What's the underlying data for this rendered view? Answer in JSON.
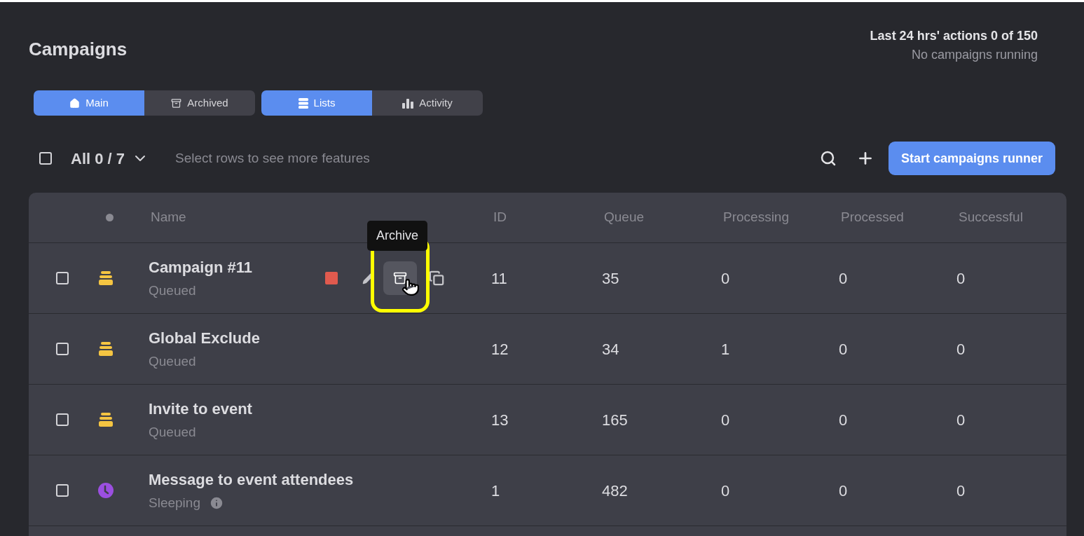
{
  "title": "Campaigns",
  "usage": {
    "actions": "Last 24 hrs' actions 0 of 150",
    "running": "No campaigns running"
  },
  "tab_groups": [
    [
      {
        "label": "Main",
        "selected": true
      },
      {
        "label": "Archived",
        "selected": false
      }
    ],
    [
      {
        "label": "Lists",
        "selected": true
      },
      {
        "label": "Activity",
        "selected": false
      }
    ]
  ],
  "selection": {
    "checked": false,
    "label": "All 0 / 7",
    "hint": "Select rows to see more features"
  },
  "start_button": "Start campaigns runner",
  "table": {
    "columns": [
      "Name",
      "ID",
      "Queue",
      "Processing",
      "Processed",
      "Successful"
    ],
    "rows": [
      {
        "name": "Campaign #11",
        "status": "Queued",
        "kind": "queued",
        "checked": false,
        "hovered": true,
        "tooltip": "Archive",
        "info": false,
        "id": "11",
        "queue": "35",
        "processing": "0",
        "processed": "0",
        "successful": "0"
      },
      {
        "name": "Global Exclude",
        "status": "Queued",
        "kind": "queued",
        "checked": false,
        "hovered": false,
        "info": false,
        "id": "12",
        "queue": "34",
        "processing": "1",
        "processed": "0",
        "successful": "0"
      },
      {
        "name": "Invite to event",
        "status": "Queued",
        "kind": "queued",
        "checked": false,
        "hovered": false,
        "info": false,
        "id": "13",
        "queue": "165",
        "processing": "0",
        "processed": "0",
        "successful": "0"
      },
      {
        "name": "Message to event attendees",
        "status": "Sleeping",
        "kind": "sleeping",
        "checked": false,
        "hovered": false,
        "info": true,
        "id": "1",
        "queue": "482",
        "processing": "0",
        "processed": "0",
        "successful": "0"
      }
    ]
  }
}
